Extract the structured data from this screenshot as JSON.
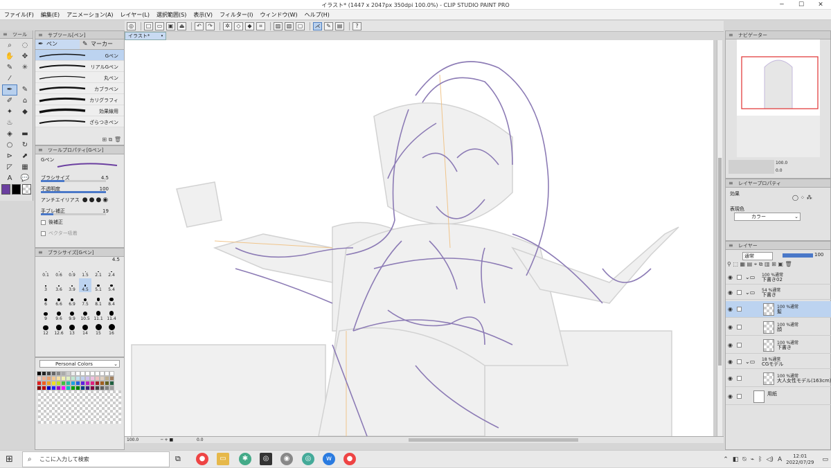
{
  "window": {
    "title": "イラスト* (1447 x 2047px 350dpi 100.0%) - CLIP STUDIO PAINT PRO",
    "min": "─",
    "max": "☐",
    "close": "✕"
  },
  "menu": [
    "ファイル(F)",
    "編集(E)",
    "アニメーション(A)",
    "レイヤー(L)",
    "選択範囲(S)",
    "表示(V)",
    "フィルター(I)",
    "ウィンドウ(W)",
    "ヘルプ(H)"
  ],
  "commandbar": {
    "icons": [
      "clip-icon",
      "new-icon",
      "open-icon",
      "save-icon",
      "export-icon",
      "undo-icon",
      "redo-icon",
      "loading-icon",
      "fill-icon",
      "transform-icon",
      "grid-icon",
      "ruler-icon",
      "snap-icon",
      "pen-snap-icon",
      "check-icon",
      "tablet-icon",
      "help-icon"
    ]
  },
  "tool_panel": {
    "title": "ツール",
    "tools": [
      "🔍",
      "◌",
      "✋",
      "✥",
      "✎",
      "✳",
      "⁄",
      "",
      "✒",
      "✎",
      "✐",
      "⌂",
      "✦",
      "◆",
      "💧",
      "",
      "◈",
      "▬",
      "○",
      "↻",
      "⊳",
      "⬈",
      "◸",
      "▦",
      "A",
      "💬"
    ]
  },
  "colors": {
    "main": "#6b3fa0",
    "sub": "#000000",
    "accent": "#4a78c8",
    "stroke": "#8c7bb5"
  },
  "subtool": {
    "title": "サブツール[ペン]",
    "tab_pen": "ペン",
    "tab_marker": "マーカー",
    "brushes": [
      "Gペン",
      "リアルGペン",
      "丸ペン",
      "カブラペン",
      "カリグラフィ",
      "効果線用",
      "ざらつきペン"
    ]
  },
  "tool_property": {
    "title": "ツールプロパティ[Gペン]",
    "name": "Gペン",
    "brush_size_label": "ブラシサイズ",
    "brush_size": "4.5",
    "opacity_label": "不透明度",
    "opacity": "100",
    "antialias_label": "アンチエイリアス",
    "stabilization_label": "手ブレ補正",
    "stabilization": "19",
    "post_correction_label": "後補正",
    "vector_label": "ベクター吸着",
    "brush_size_pct": 0.36,
    "opacity_pct": 1.0,
    "stabilization_pct": 0.19
  },
  "brush_size_palette": {
    "title": "ブラシサイズ[Gペン]",
    "current": "4.5",
    "sizes": [
      "0.1",
      "0.6",
      "0.9",
      "1.5",
      "2.1",
      "2.4",
      "3",
      "3.6",
      "3.9",
      "4.5",
      "5.1",
      "5.4",
      "6",
      "6.6",
      "6.9",
      "7.5",
      "8.1",
      "8.4",
      "9",
      "9.6",
      "9.9",
      "10.5",
      "11.1",
      "11.4",
      "12",
      "12.6",
      "13",
      "14",
      "15",
      "16"
    ]
  },
  "color_set": {
    "name": "Personal Colors"
  },
  "document": {
    "tab": "イラスト*",
    "zoom": "100.0",
    "angle": "0.0"
  },
  "navigator": {
    "title": "ナビゲーター",
    "zoom": "100.0",
    "angle": "0.0"
  },
  "layer_property": {
    "title": "レイヤープロパティ",
    "effect_label": "効果",
    "expression_label": "表現色",
    "expression_value": "カラー"
  },
  "layers": {
    "title": "レイヤー",
    "blend": "通常",
    "opacity": "100",
    "rows": [
      {
        "mode": "100 %通常",
        "name": "下書き02",
        "type": "folder"
      },
      {
        "mode": "54 %通常",
        "name": "下書き",
        "type": "folder"
      },
      {
        "mode": "100 %通常",
        "name": "髪",
        "type": "raster",
        "selected": true
      },
      {
        "mode": "100 %通常",
        "name": "顔",
        "type": "raster"
      },
      {
        "mode": "100 %通常",
        "name": "下書き",
        "type": "raster"
      },
      {
        "mode": "18 %通常",
        "name": "CGモデル",
        "type": "folder"
      },
      {
        "mode": "100 %通常",
        "name": "大人女性モデル(163cm)",
        "type": "3d"
      },
      {
        "mode": "",
        "name": "用紙",
        "type": "paper"
      }
    ]
  },
  "taskbar": {
    "search_placeholder": "ここに入力して検索",
    "time": "12:01",
    "date": "2022/07/29",
    "ime": "A"
  }
}
